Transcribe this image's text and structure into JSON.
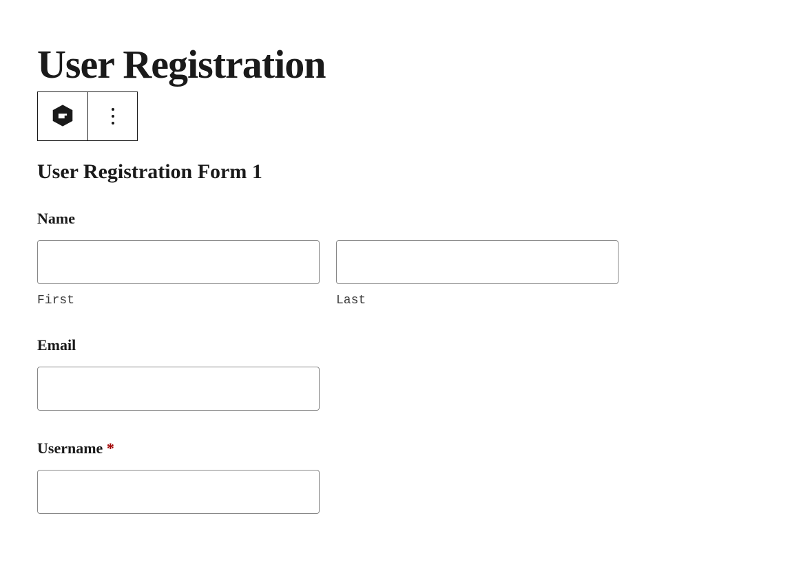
{
  "page": {
    "title": "User Registration"
  },
  "form": {
    "title": "User Registration Form 1",
    "fields": {
      "name": {
        "label": "Name",
        "first": {
          "value": "",
          "sublabel": "First"
        },
        "last": {
          "value": "",
          "sublabel": "Last"
        }
      },
      "email": {
        "label": "Email",
        "value": ""
      },
      "username": {
        "label": "Username ",
        "required_marker": "*",
        "value": ""
      }
    }
  }
}
